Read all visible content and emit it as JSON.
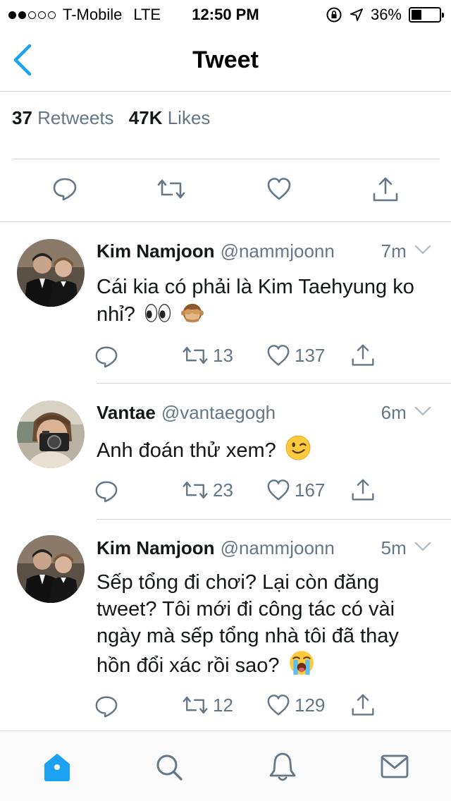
{
  "status_bar": {
    "carrier": "T-Mobile",
    "network": "LTE",
    "time": "12:50 PM",
    "battery": "36%",
    "battery_level": 0.36,
    "signal_bars": 2
  },
  "nav": {
    "title": "Tweet",
    "back_icon": "chevron-left-icon",
    "accent_color": "#1da1f2"
  },
  "stats": {
    "retweets_count": "37",
    "retweets_label": "Retweets",
    "likes_count": "47K",
    "likes_label": "Likes"
  },
  "actions": [
    "reply-icon",
    "retweet-icon",
    "heart-icon",
    "share-icon"
  ],
  "replies": [
    {
      "name": "Kim Namjoon",
      "handle": "@nammjoonn",
      "time": "7m",
      "text": "Cái kia có phải là Kim Taehyung ko nhỉ?",
      "emojis": [
        "eyes-emoji",
        "see-no-evil-monkey-emoji"
      ],
      "retweets": "13",
      "likes": "137"
    },
    {
      "name": "Vantae",
      "handle": "@vantaegogh",
      "time": "6m",
      "text": "Anh đoán thử xem?",
      "emojis": [
        "winking-face-emoji"
      ],
      "retweets": "23",
      "likes": "167"
    },
    {
      "name": "Kim Namjoon",
      "handle": "@nammjoonn",
      "time": "5m",
      "text": "Sếp tổng đi chơi? Lại còn đăng tweet? Tôi mới đi công tác có vài ngày mà sếp tổng nhà tôi đã thay hồn đổi xác rồi sao?",
      "emojis": [
        "loudly-crying-face-emoji"
      ],
      "retweets": "12",
      "likes": "129"
    }
  ],
  "tab_bar": [
    "home-icon",
    "search-icon",
    "notifications-icon",
    "messages-icon"
  ],
  "colors": {
    "text": "#14171a",
    "secondary": "#657786",
    "icon": "#657786",
    "accent": "#1da1f2",
    "divider": "#cfd4d8"
  }
}
